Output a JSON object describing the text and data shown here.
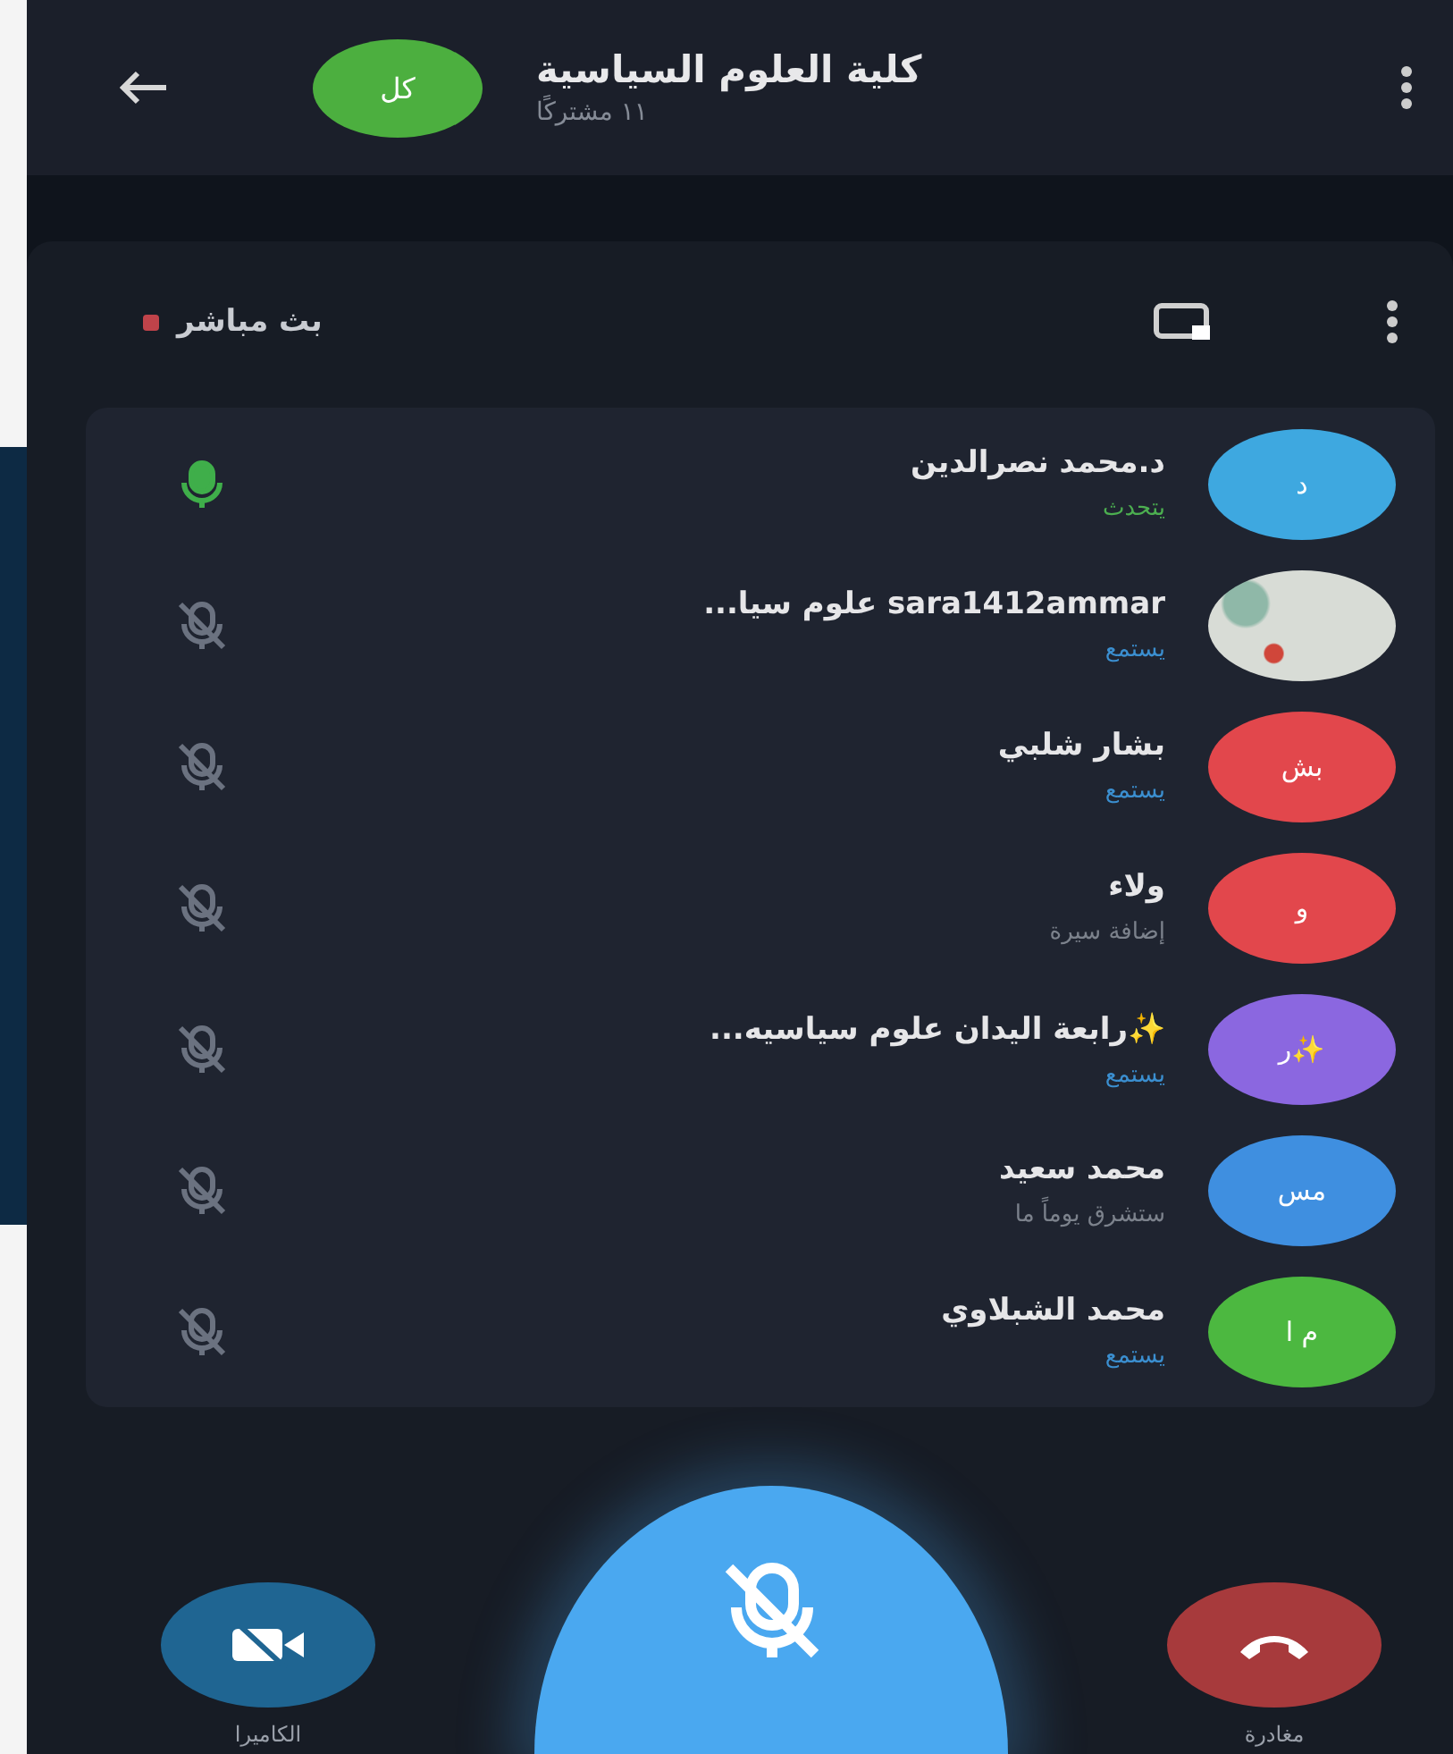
{
  "header": {
    "title": "كلية العلوم السياسية",
    "subtitle": "١١ مشتركًا",
    "avatar": {
      "initials": "كل",
      "color": "#4caf3f"
    }
  },
  "live": {
    "label": "بث مباشر"
  },
  "participants": [
    {
      "name": "د.محمد نصرالدين",
      "status": "يتحدث",
      "kind": "speaking",
      "muted": false,
      "avatar": {
        "initials": "د",
        "color": "#3ea8e0",
        "photo": false
      }
    },
    {
      "name": "sara1412ammar علوم سيا...",
      "status": "يستمع",
      "kind": "listening",
      "muted": true,
      "avatar": {
        "color": "#d8dcd6",
        "photo": true
      }
    },
    {
      "name": "بشار شلبي",
      "status": "يستمع",
      "kind": "listening",
      "muted": true,
      "avatar": {
        "initials": "بش",
        "color": "#e2474c",
        "photo": false
      }
    },
    {
      "name": "ولاء",
      "status": "إضافة سيرة",
      "kind": "bio",
      "muted": true,
      "avatar": {
        "initials": "و",
        "color": "#e2474c",
        "photo": false
      }
    },
    {
      "name": "✨رابعة اليدان علوم سياسيه...",
      "status": "يستمع",
      "kind": "listening",
      "muted": true,
      "avatar": {
        "initials": "ر✨",
        "color": "#8b67e0",
        "photo": false
      }
    },
    {
      "name": "محمد سعيد",
      "status": "ستشرق يوماً ما",
      "kind": "bio",
      "muted": true,
      "avatar": {
        "initials": "مس",
        "color": "#3f8fe0",
        "photo": false
      }
    },
    {
      "name": "محمد الشبلاوي",
      "status": "يستمع",
      "kind": "listening",
      "muted": true,
      "avatar": {
        "initials": "م ا",
        "color": "#4cb840",
        "photo": false
      }
    }
  ],
  "controls": {
    "camera": {
      "label": "الكاميرا"
    },
    "mic": {
      "muted": true
    },
    "leave": {
      "label": "مغادرة"
    }
  }
}
